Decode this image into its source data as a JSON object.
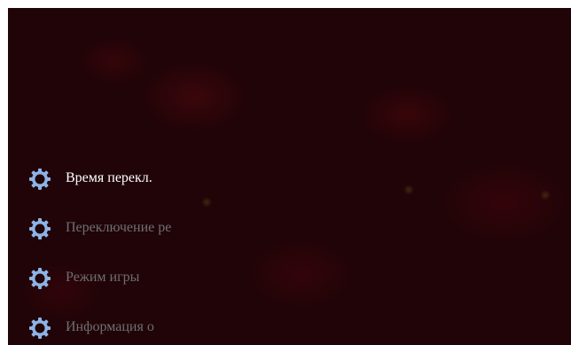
{
  "menu": {
    "items": [
      {
        "label": "Время перекл.",
        "icon": "gear-icon",
        "active": true
      },
      {
        "label": "Переключение ре",
        "icon": "gear-icon",
        "active": false
      },
      {
        "label": "Режим игры",
        "icon": "gear-icon",
        "active": false
      },
      {
        "label": "Информация о",
        "icon": "gear-icon",
        "active": false
      }
    ]
  },
  "colors": {
    "icon": "#8fb3e6",
    "active_text": "#ffffff",
    "inactive_text": "#6f6f72",
    "background": "#200408"
  }
}
